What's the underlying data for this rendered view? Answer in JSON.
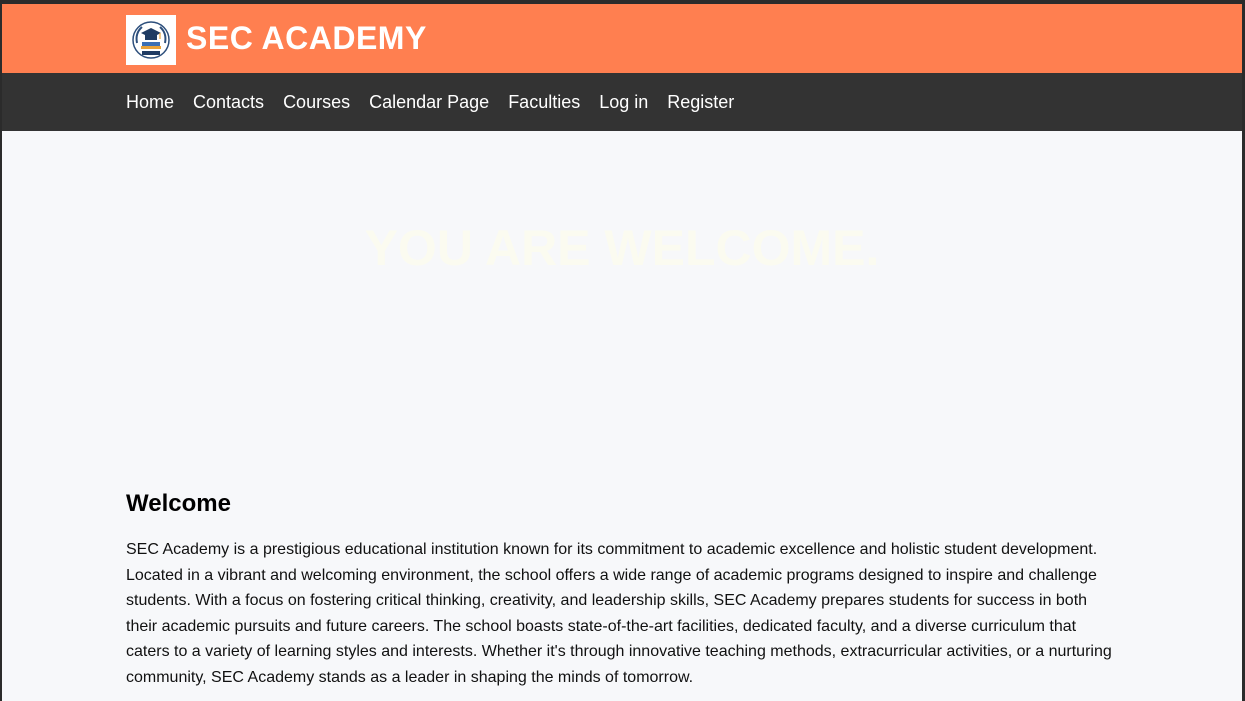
{
  "header": {
    "site_title": "SEC ACADEMY",
    "logo_icon": "graduation-cap-emblem-icon",
    "background_color": "#ff7f50"
  },
  "nav": {
    "items": [
      {
        "label": "Home"
      },
      {
        "label": "Contacts"
      },
      {
        "label": "Courses"
      },
      {
        "label": "Calendar Page"
      },
      {
        "label": "Faculties"
      },
      {
        "label": "Log in"
      },
      {
        "label": "Register"
      }
    ],
    "background_color": "#333333"
  },
  "hero": {
    "headline": "YOU ARE WELCOME."
  },
  "welcome": {
    "heading": "Welcome",
    "body": "SEC Academy is a prestigious educational institution known for its commitment to academic excellence and holistic student development. Located in a vibrant and welcoming environment, the school offers a wide range of academic programs designed to inspire and challenge students. With a focus on fostering critical thinking, creativity, and leadership skills, SEC Academy prepares students for success in both their academic pursuits and future careers. The school boasts state-of-the-art facilities, dedicated faculty, and a diverse curriculum that caters to a variety of learning styles and interests. Whether it's through innovative teaching methods, extracurricular activities, or a nurturing community, SEC Academy stands as a leader in shaping the minds of tomorrow."
  }
}
